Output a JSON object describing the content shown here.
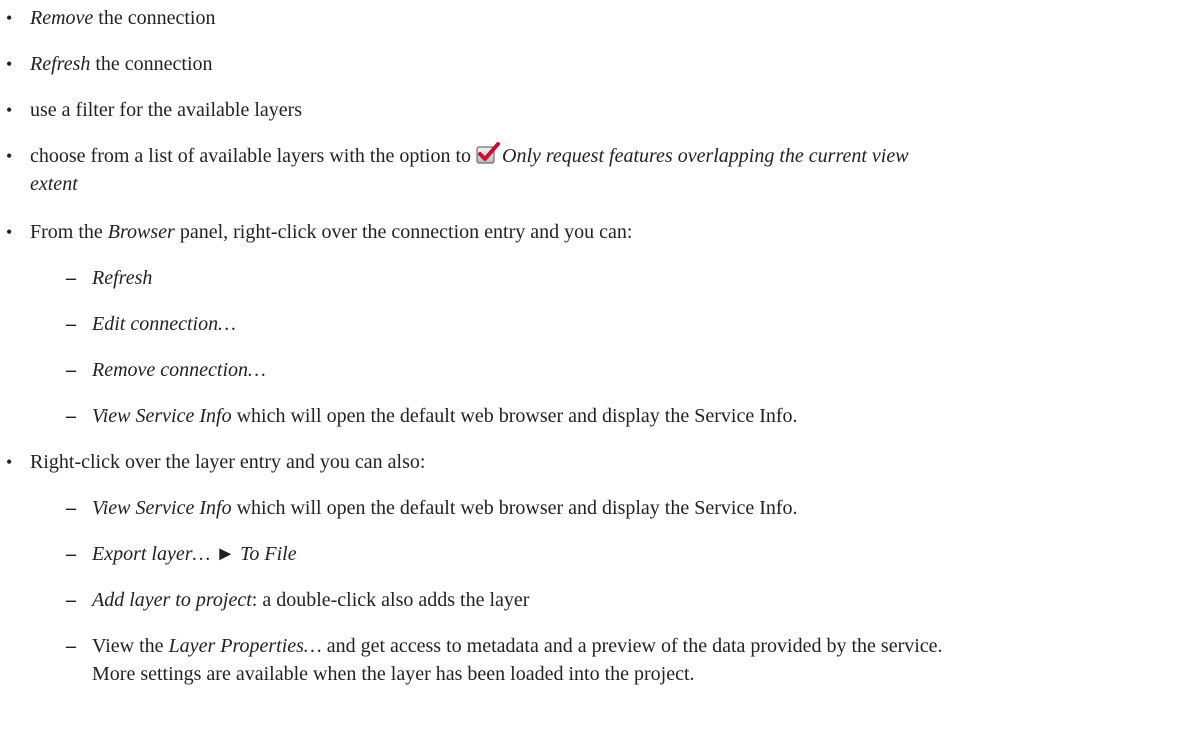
{
  "items": [
    {
      "em": "Remove",
      "rest": " the connection"
    },
    {
      "em": "Refresh",
      "rest": " the connection"
    },
    {
      "text": "use a filter for the available layers"
    },
    {
      "pre": "choose from a list of available layers with the option to ",
      "icon": "checked-checkbox-icon",
      "em_line1": "Only request features overlapping the current view",
      "em_line2": "extent"
    },
    {
      "pre": "From the ",
      "em": "Browser",
      "rest": " panel, right-click over the connection entry and you can:"
    },
    {
      "em": "Refresh"
    },
    {
      "em": "Edit connection…"
    },
    {
      "em": "Remove connection…"
    },
    {
      "em": "View Service Info",
      "rest": " which will open the default web browser and display the Service Info."
    },
    {
      "text": "Right-click over the layer entry and you can also:"
    },
    {
      "em": "View Service Info",
      "rest": " which will open the default web browser and display the Service Info."
    },
    {
      "em": "Export layer…",
      "arrow": " ► ",
      "em2": "To File"
    },
    {
      "em": "Add layer to project",
      "rest": ": a double-click also adds the layer"
    },
    {
      "pre": "View the ",
      "em": "Layer Properties…",
      "rest": " and get access to metadata and a preview of the data provided by the service.",
      "line2": "More settings are available when the layer has been loaded into the project."
    }
  ],
  "markers": {
    "bullet": "•",
    "dash": "–"
  },
  "colors": {
    "text": "#222222",
    "checkbox_check": "#c8102e"
  }
}
